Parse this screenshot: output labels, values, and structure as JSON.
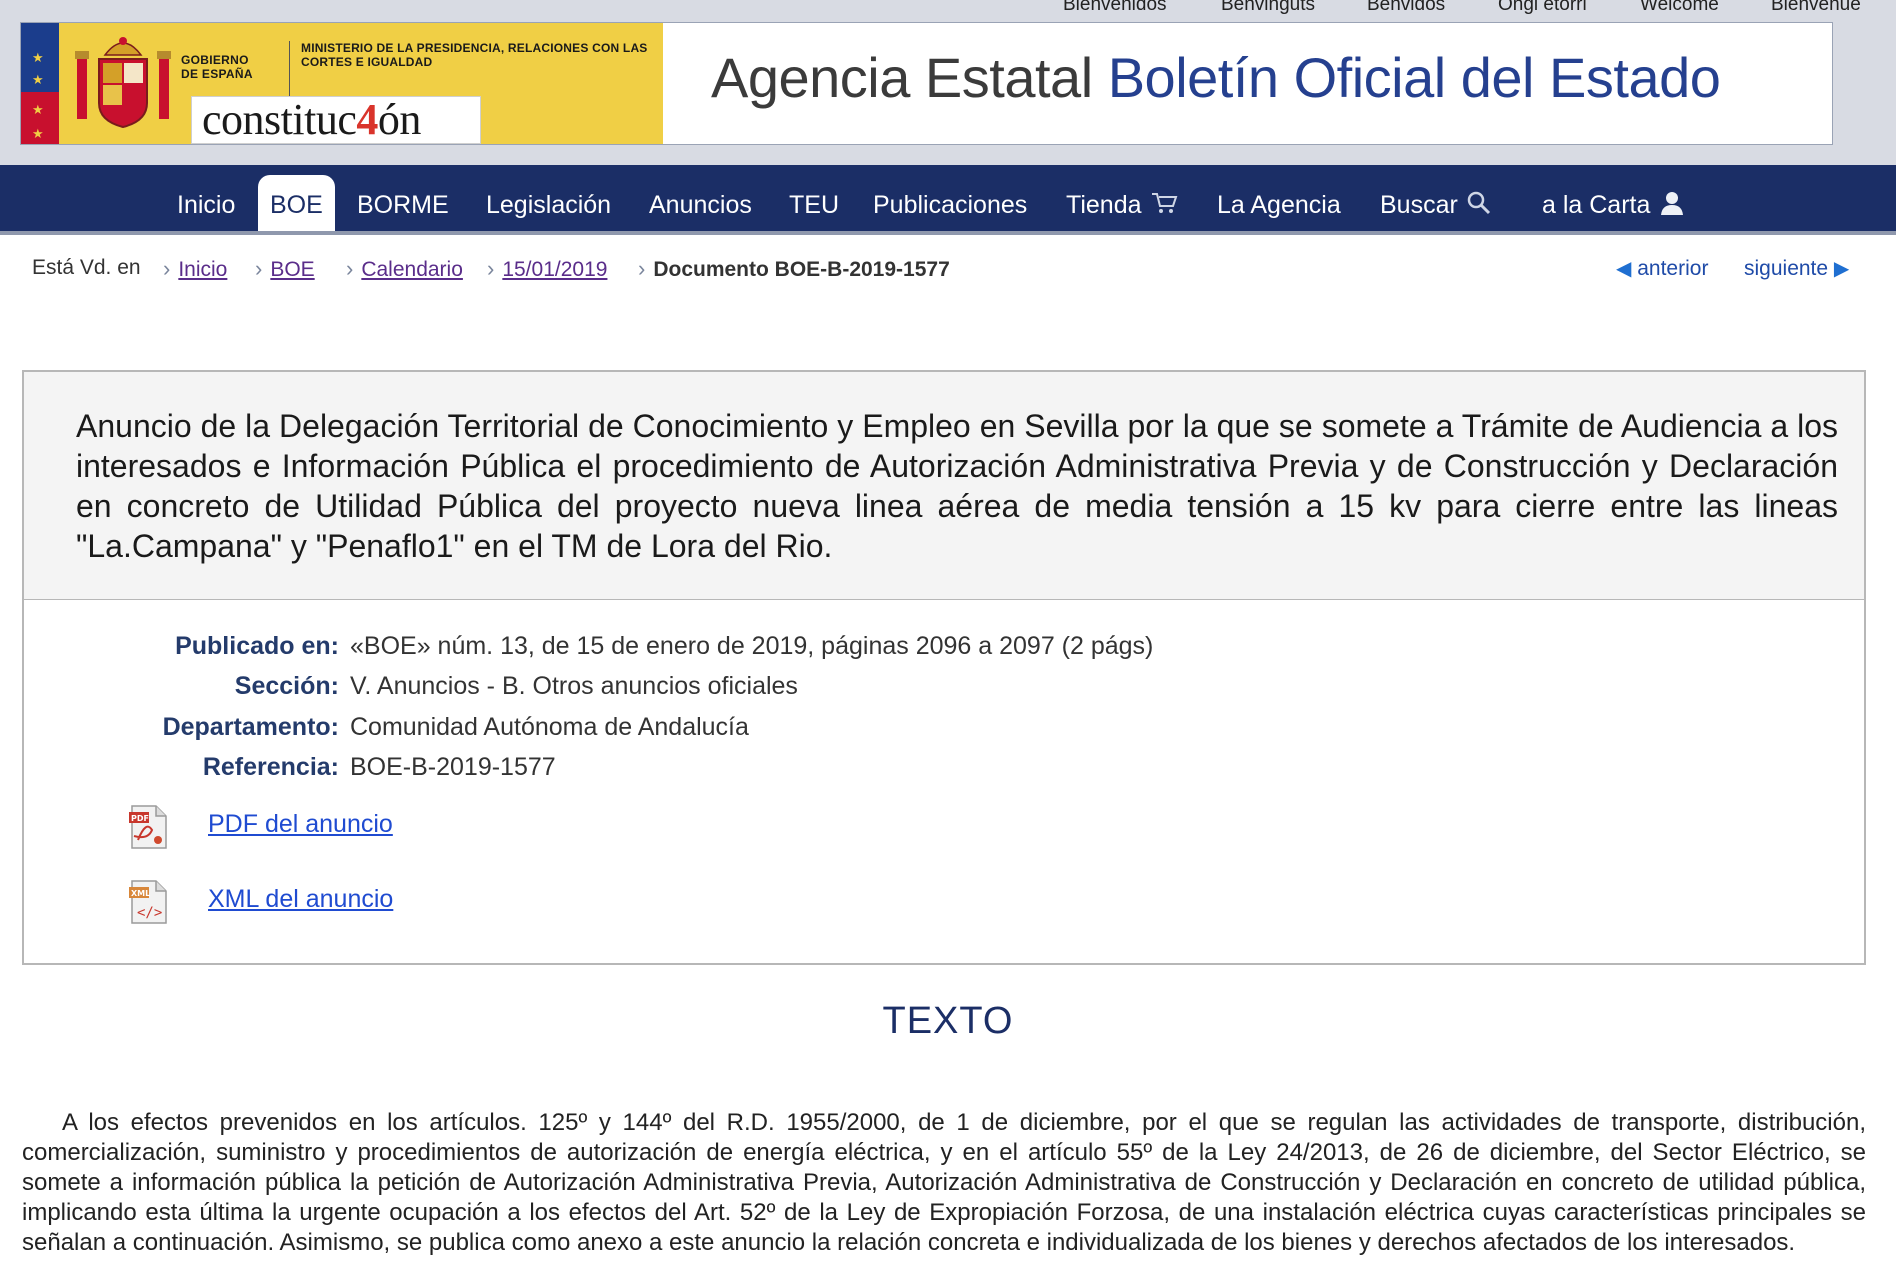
{
  "lang_bar": [
    "Bienvenidos",
    "Benvinguts",
    "Benvidos",
    "Ongi etorri",
    "Welcome",
    "Bienvenue"
  ],
  "header": {
    "gobierno": "GOBIERNO DE ESPAÑA",
    "ministerio": "MINISTERIO DE LA PRESIDENCIA, RELACIONES CON LAS CORTES E IGUALDAD",
    "constitucion_pre": "constituc",
    "constitucion_num": "4",
    "constitucion_post": "ón",
    "agency_part1": "Agencia Estatal",
    "agency_part2": "Boletín Oficial del Estado"
  },
  "nav": {
    "items": [
      "Inicio",
      "BOE",
      "BORME",
      "Legislación",
      "Anuncios",
      "TEU",
      "Publicaciones",
      "Tienda",
      "La Agencia",
      "Buscar",
      "a la Carta"
    ],
    "active": "BOE"
  },
  "breadcrumb": {
    "prefix": "Está Vd. en",
    "links": [
      "Inicio",
      "BOE",
      "Calendario",
      "15/01/2019"
    ],
    "current": "Documento BOE-B-2019-1577"
  },
  "pager": {
    "prev": "anterior",
    "next": "siguiente"
  },
  "document": {
    "title": "Anuncio de la Delegación Territorial de Conocimiento y Empleo en Sevilla por la que se somete a Trámite de Audiencia a los interesados e Información Pública el procedimiento de Autorización Administrativa Previa y de Construcción y Declaración en concreto de Utilidad Pública del proyecto nueva linea aérea de media tensión a 15 kv para cierre entre las lineas \"La.Campana\" y \"Penaflo1\" en el TM de Lora del Rio.",
    "meta": [
      {
        "label": "Publicado en:",
        "value": "«BOE» núm. 13, de 15 de enero de 2019, páginas 2096 a 2097 (2 págs)"
      },
      {
        "label": "Sección:",
        "value": "V. Anuncios - B. Otros anuncios oficiales"
      },
      {
        "label": "Departamento:",
        "value": "Comunidad Autónoma de Andalucía"
      },
      {
        "label": "Referencia:",
        "value": "BOE-B-2019-1577"
      }
    ],
    "downloads": {
      "pdf": "PDF del anuncio",
      "xml": "XML del anuncio"
    }
  },
  "texto": {
    "heading": "TEXTO",
    "paragraph": "A los efectos prevenidos en los artículos. 125º y 144º del R.D. 1955/2000, de 1 de diciembre, por el que se regulan las actividades de transporte, distribución, comercialización, suministro y procedimientos de autorización de energía eléctrica, y en el artículo 55º de la Ley 24/2013, de 26 de diciembre, del Sector Eléctrico, se somete a información pública la petición de Autorización Administrativa Previa, Autorización Administrativa de Construcción y Declaración en concreto de utilidad pública, implicando esta última la urgente ocupación a los efectos del Art. 52º de la Ley de Expropiación Forzosa, de una instalación eléctrica cuyas características principales se señalan a continuación. Asimismo, se publica como anexo a este anuncio la relación concreta e individualizada de los bienes y derechos afectados de los interesados."
  },
  "colors": {
    "nav_bg": "#1b2e66",
    "brand_blue": "#25408f",
    "gov_yellow": "#f0cf45",
    "link": "#1f4bd1"
  }
}
